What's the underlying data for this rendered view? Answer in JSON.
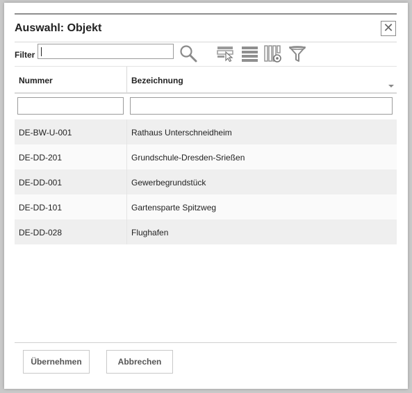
{
  "dialog": {
    "title": "Auswahl: Objekt",
    "close_icon": "close-icon"
  },
  "filter": {
    "label": "Filter",
    "value": "",
    "search_icon": "search-icon",
    "tools": [
      "select-row-icon",
      "list-view-icon",
      "column-settings-icon",
      "filter-funnel-icon"
    ]
  },
  "table": {
    "columns": [
      {
        "label": "Nummer"
      },
      {
        "label": "Bezeichnung"
      }
    ],
    "column_filters": [
      "",
      ""
    ],
    "rows": [
      {
        "nummer": "DE-BW-U-001",
        "bezeichnung": "Rathaus Unterschneidheim"
      },
      {
        "nummer": "DE-DD-201",
        "bezeichnung": "Grundschule-Dresden-Srießen"
      },
      {
        "nummer": "DE-DD-001",
        "bezeichnung": "Gewerbegrundstück"
      },
      {
        "nummer": "DE-DD-101",
        "bezeichnung": "Gartensparte Spitzweg"
      },
      {
        "nummer": "DE-DD-028",
        "bezeichnung": "Flughafen"
      }
    ]
  },
  "footer": {
    "accept_label": "Übernehmen",
    "cancel_label": "Abbrechen"
  }
}
